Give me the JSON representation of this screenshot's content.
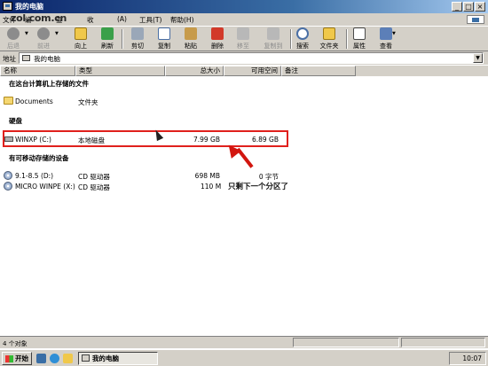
{
  "window": {
    "title": "我的电脑"
  },
  "watermark": "zol.com.cn",
  "menu": {
    "items": [
      "文件",
      "编",
      "查",
      "收",
      "(A)",
      "工具(T)",
      "帮助(H)"
    ]
  },
  "toolbar": {
    "back": "后退",
    "forward": "前进",
    "up": "向上",
    "refresh": "刷新",
    "cut": "剪切",
    "copy": "复制",
    "paste": "粘贴",
    "delete": "删除",
    "move_to": "移至",
    "copy_to": "复制到",
    "search": "搜索",
    "folders": "文件夹",
    "properties": "属性",
    "views": "查看"
  },
  "address": {
    "label": "地址",
    "value": "我的电脑"
  },
  "columns": {
    "name": "名称",
    "type": "类型",
    "total": "总大小",
    "free": "可用空间",
    "comment": "备注"
  },
  "groups": {
    "stored": "在这台计算机上存储的文件",
    "hard_disks": "硬盘",
    "removable": "有可移动存储的设备"
  },
  "stored_items": [
    {
      "name": "Documents",
      "type": "文件夹"
    }
  ],
  "disks": [
    {
      "name": "WINXP (C:)",
      "type": "本地磁盘",
      "total": "7.99 GB",
      "free": "6.89 GB"
    }
  ],
  "removable_items": [
    {
      "name": "9.1-8.5 (D:)",
      "type": "CD 驱动器",
      "total": "698 MB",
      "free": "0 字节"
    },
    {
      "name": "MICRO WINPE (X:)",
      "type": "CD 驱动器",
      "total": "110 M",
      "free": ""
    }
  ],
  "annotation": "只剩下一个分区了",
  "status": {
    "text": "4 个对象"
  },
  "taskbar": {
    "start": "开始",
    "task": "我的电脑",
    "clock": "10:07"
  },
  "colors": {
    "highlight": "#e0201c",
    "title_bar": "#0a246a",
    "chrome": "#d4d0c8"
  }
}
